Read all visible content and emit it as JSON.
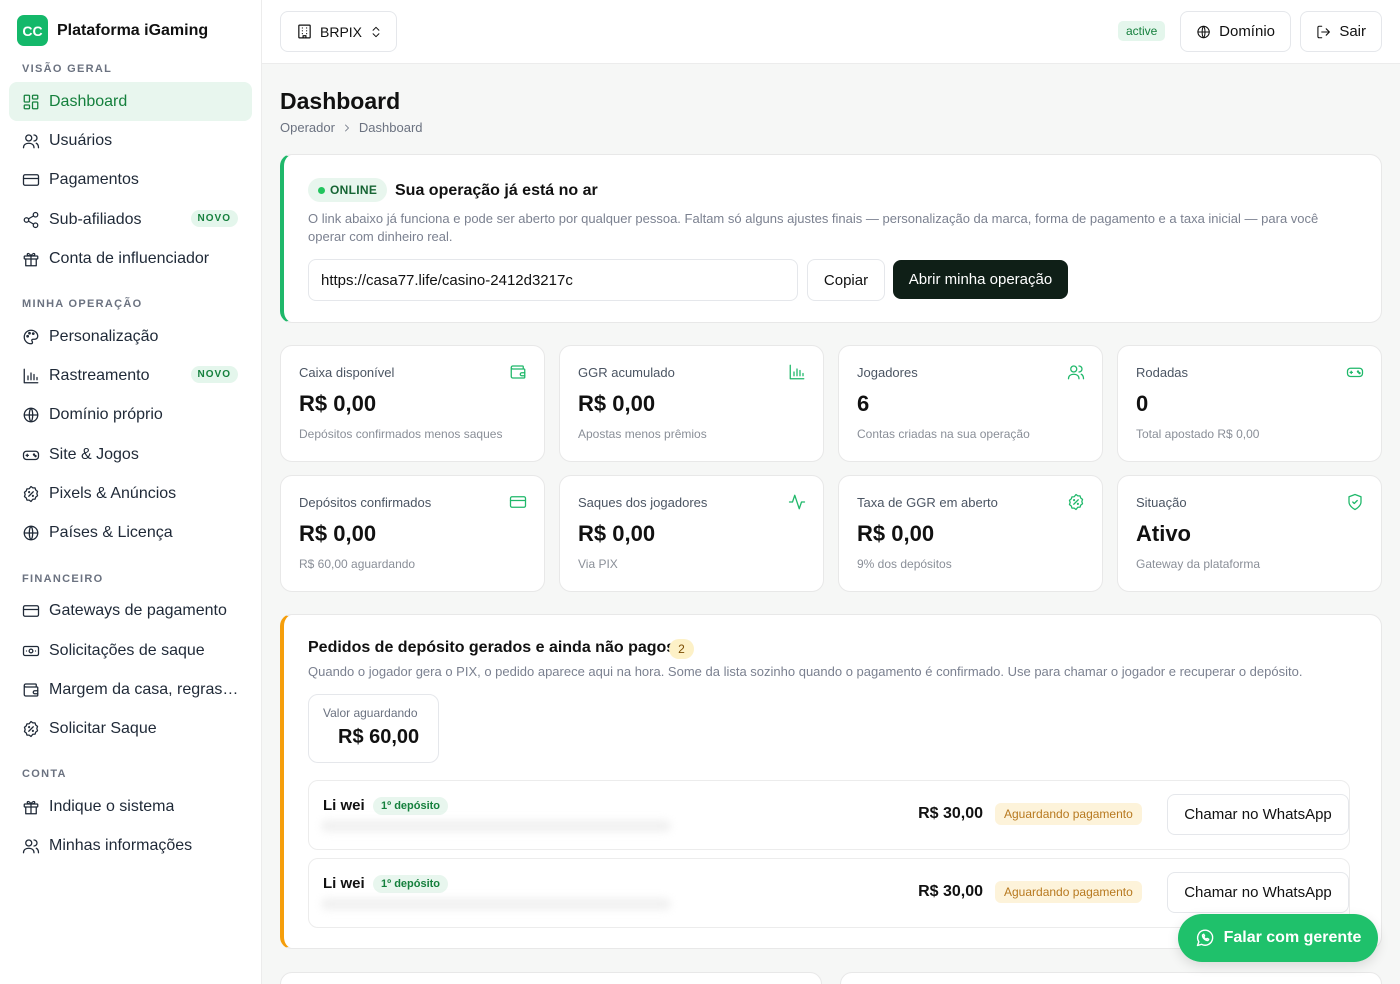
{
  "brand": {
    "logo": "CC",
    "name": "Plataforma iGaming"
  },
  "sidebar": {
    "sections": [
      {
        "label": "VISÃO GERAL"
      },
      {
        "label": "MINHA OPERAÇÃO"
      },
      {
        "label": "FINANCEIRO"
      },
      {
        "label": "CONTA"
      }
    ],
    "items": [
      {
        "label": "Dashboard",
        "icon": "dashboard-icon",
        "active": true
      },
      {
        "label": "Usuários",
        "icon": "users-icon"
      },
      {
        "label": "Pagamentos",
        "icon": "card-icon"
      },
      {
        "label": "Sub-afiliados",
        "icon": "share-icon",
        "badge": "NOVO"
      },
      {
        "label": "Conta de influenciador",
        "icon": "gift-icon"
      },
      {
        "label": "Personalização",
        "icon": "palette-icon"
      },
      {
        "label": "Rastreamento",
        "icon": "chart-bar-icon",
        "badge": "NOVO"
      },
      {
        "label": "Domínio próprio",
        "icon": "globe-icon"
      },
      {
        "label": "Site & Jogos",
        "icon": "gamepad-icon"
      },
      {
        "label": "Pixels & Anúncios",
        "icon": "badge-percent-icon"
      },
      {
        "label": "Países & Licença",
        "icon": "globe-icon"
      },
      {
        "label": "Gateways de pagamento",
        "icon": "card-icon"
      },
      {
        "label": "Solicitações de saque",
        "icon": "cash-icon"
      },
      {
        "label": "Margem da casa, regras & limites",
        "icon": "wallet-icon"
      },
      {
        "label": "Solicitar Saque",
        "icon": "badge-percent-icon"
      },
      {
        "label": "Indique o sistema",
        "icon": "gift-icon"
      },
      {
        "label": "Minhas informações",
        "icon": "users-icon"
      }
    ]
  },
  "topbar": {
    "tenant": "BRPIX",
    "status": "active",
    "domain_label": "Domínio",
    "logout_label": "Sair"
  },
  "page": {
    "title": "Dashboard",
    "breadcrumb": [
      "Operador",
      "Dashboard"
    ]
  },
  "online": {
    "pill": "ONLINE",
    "title": "Sua operação já está no ar",
    "description": "O link abaixo já funciona e pode ser aberto por qualquer pessoa. Faltam só alguns ajustes finais — personalização da marca, forma de pagamento e a taxa inicial — para você operar com dinheiro real.",
    "url": "https://casa77.life/casino-2412d3217c",
    "copy_label": "Copiar",
    "open_label": "Abrir minha operação"
  },
  "stats": [
    {
      "label": "Caixa disponível",
      "value": "R$ 0,00",
      "sub": "Depósitos confirmados menos saques",
      "icon": "wallet-icon"
    },
    {
      "label": "GGR acumulado",
      "value": "R$ 0,00",
      "sub": "Apostas menos prêmios",
      "icon": "chart-bar-icon"
    },
    {
      "label": "Jogadores",
      "value": "6",
      "sub": "Contas criadas na sua operação",
      "icon": "users-icon"
    },
    {
      "label": "Rodadas",
      "value": "0",
      "sub": "Total apostado R$ 0,00",
      "icon": "gamepad-icon"
    },
    {
      "label": "Depósitos confirmados",
      "value": "R$ 0,00",
      "sub": "R$ 60,00 aguardando",
      "icon": "card-icon"
    },
    {
      "label": "Saques dos jogadores",
      "value": "R$ 0,00",
      "sub": "Via PIX",
      "icon": "activity-icon"
    },
    {
      "label": "Taxa de GGR em aberto",
      "value": "R$ 0,00",
      "sub": "9% dos depósitos",
      "icon": "badge-percent-icon"
    },
    {
      "label": "Situação",
      "value": "Ativo",
      "sub": "Gateway da plataforma",
      "icon": "shield-check-icon"
    }
  ],
  "orders": {
    "title": "Pedidos de depósito gerados e ainda não pagos",
    "count": "2",
    "description": "Quando o jogador gera o PIX, o pedido aparece aqui na hora. Some da lista sozinho quando o pagamento é confirmado. Use para chamar o jogador e recuperar o depósito.",
    "await_label": "Valor aguardando",
    "await_value": "R$ 60,00",
    "rows": [
      {
        "name": "Li wei",
        "tag": "1º depósito",
        "amount": "R$ 30,00",
        "status": "Aguardando pagamento",
        "action": "Chamar no WhatsApp"
      },
      {
        "name": "Li wei",
        "tag": "1º depósito",
        "amount": "R$ 30,00",
        "status": "Aguardando pagamento",
        "action": "Chamar no WhatsApp"
      }
    ]
  },
  "fab": {
    "label": "Falar com gerente",
    "icon": "whatsapp-icon"
  },
  "colors": {
    "accent": "#1fb86a",
    "warning": "#f59e0b",
    "dark_button": "#0f1f17"
  }
}
